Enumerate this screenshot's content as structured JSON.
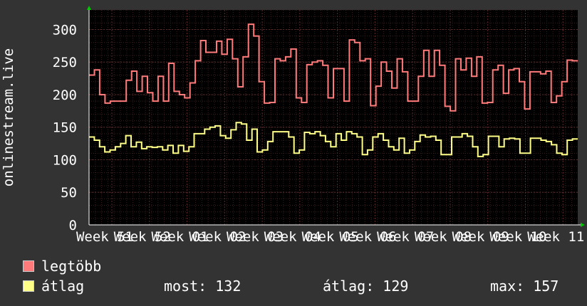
{
  "chart_data": {
    "type": "line",
    "ylabel": "onlinestream.live",
    "ylim": [
      0,
      330
    ],
    "yticks": [
      0,
      50,
      100,
      150,
      200,
      250,
      300
    ],
    "x_tick_labels": [
      "Week 51",
      "Week 52",
      "Week 01",
      "Week 02",
      "Week 03",
      "Week 04",
      "Week 05",
      "Week 06",
      "Week 07",
      "Week 08",
      "Week 09",
      "Week 10",
      "Week 11"
    ],
    "colors": {
      "background": "#333333",
      "plot": "#000000",
      "grid": "#5a2a2a",
      "legtobb": "#ff7a7a",
      "atlag": "#ffff88",
      "axis_arrow": "#00cc00"
    },
    "series": [
      {
        "name": "legtöbb",
        "values": [
          230,
          238,
          200,
          187,
          190,
          190,
          190,
          222,
          236,
          205,
          228,
          203,
          190,
          228,
          190,
          248,
          205,
          200,
          195,
          218,
          252,
          283,
          265,
          265,
          282,
          262,
          285,
          255,
          212,
          258,
          308,
          290,
          220,
          187,
          188,
          255,
          252,
          258,
          270,
          195,
          188,
          246,
          250,
          252,
          245,
          195,
          240,
          240,
          190,
          284,
          280,
          252,
          255,
          183,
          213,
          250,
          236,
          210,
          255,
          235,
          190,
          190,
          228,
          268,
          228,
          268,
          245,
          182,
          175,
          255,
          238,
          256,
          228,
          258,
          187,
          188,
          238,
          245,
          202,
          238,
          240,
          220,
          178,
          235,
          235,
          232,
          236,
          188,
          198,
          220,
          253,
          252
        ]
      },
      {
        "name": "átlag",
        "values": [
          135,
          130,
          120,
          112,
          115,
          120,
          125,
          137,
          120,
          127,
          117,
          120,
          119,
          120,
          115,
          122,
          110,
          122,
          113,
          120,
          140,
          140,
          147,
          150,
          152,
          137,
          133,
          146,
          157,
          155,
          130,
          147,
          112,
          115,
          128,
          143,
          143,
          143,
          135,
          110,
          115,
          142,
          140,
          143,
          137,
          128,
          120,
          140,
          130,
          143,
          140,
          135,
          108,
          115,
          135,
          140,
          130,
          120,
          115,
          133,
          110,
          115,
          128,
          138,
          135,
          136,
          130,
          108,
          108,
          135,
          135,
          140,
          136,
          120,
          105,
          108,
          136,
          136,
          120,
          132,
          133,
          132,
          110,
          110,
          133,
          133,
          130,
          128,
          123,
          110,
          108,
          130,
          132
        ]
      }
    ],
    "legend": [
      {
        "label": "legtöbb",
        "color": "#ff7a7a"
      },
      {
        "label": "átlag",
        "color": "#ffff88"
      }
    ],
    "stats": {
      "most": "most: 132",
      "atlag": "átlag: 129",
      "max": "max: 157"
    }
  }
}
